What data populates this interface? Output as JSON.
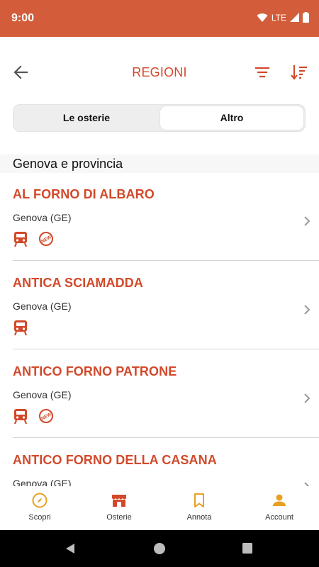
{
  "status_bar": {
    "time": "9:00",
    "network": "LTE"
  },
  "app_bar": {
    "title": "REGIONI"
  },
  "segments": [
    {
      "label": "Le osterie",
      "selected": false
    },
    {
      "label": "Altro",
      "selected": true
    }
  ],
  "section": {
    "title": "Genova e provincia"
  },
  "items": [
    {
      "name": "AL FORNO DI ALBARO",
      "city": "Genova (GE)",
      "icons": [
        "train-icon",
        "new-badge-icon"
      ]
    },
    {
      "name": "ANTICA SCIAMADDA",
      "city": "Genova (GE)",
      "icons": [
        "train-icon"
      ]
    },
    {
      "name": "ANTICO FORNO PATRONE",
      "city": "Genova (GE)",
      "icons": [
        "train-icon",
        "new-badge-icon"
      ]
    },
    {
      "name": "ANTICO FORNO DELLA CASANA",
      "city": "Genova (GE)",
      "icons": []
    }
  ],
  "new_badge_text": "NEW",
  "bottom_nav": [
    {
      "label": "Scopri",
      "icon": "compass-icon"
    },
    {
      "label": "Osterie",
      "icon": "storefront-icon"
    },
    {
      "label": "Annota",
      "icon": "bookmark-icon"
    },
    {
      "label": "Account",
      "icon": "person-icon"
    }
  ],
  "colors": {
    "status_bar": "#d35d3b",
    "accent": "#d2492a",
    "orange_icon": "#e8a020",
    "divider": "#d4d4d4"
  }
}
